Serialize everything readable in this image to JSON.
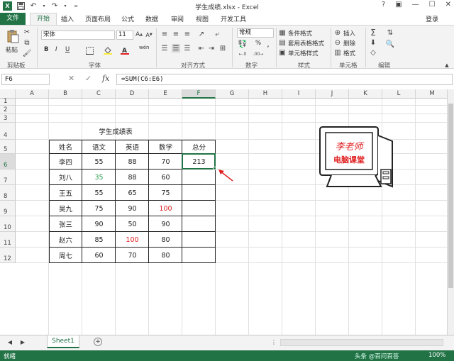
{
  "window": {
    "title": "学生成绩.xlsx - Excel",
    "controls": [
      "?",
      "▣",
      "—",
      "☐",
      "✕"
    ]
  },
  "ribbon_tabs": {
    "file": "文件",
    "active": "开始",
    "items": [
      "插入",
      "页面布局",
      "公式",
      "数据",
      "审阅",
      "视图",
      "开发工具"
    ],
    "signin": "登录"
  },
  "ribbon": {
    "clipboard": {
      "paste": "粘贴",
      "label": "剪贴板"
    },
    "font": {
      "name": "宋体",
      "size": "11",
      "bold": "B",
      "italic": "I",
      "underline": "U",
      "label": "字体",
      "wen": "wén"
    },
    "alignment": {
      "label": "对齐方式"
    },
    "number": {
      "format": "常规",
      "percent": "%",
      "label": "数字"
    },
    "styles": {
      "conditional": "条件格式",
      "table": "套用表格格式",
      "cell": "单元格样式",
      "label": "样式"
    },
    "cells": {
      "insert": "插入",
      "delete": "删除",
      "format": "格式",
      "label": "单元格"
    },
    "editing": {
      "label": "编辑"
    }
  },
  "formula_bar": {
    "name_box": "F6",
    "formula": "=SUM(C6:E6)"
  },
  "grid": {
    "columns": [
      "A",
      "B",
      "C",
      "D",
      "E",
      "F",
      "G",
      "H",
      "I",
      "J",
      "K",
      "L",
      "M"
    ],
    "rows": [
      "1",
      "2",
      "3",
      "4",
      "5",
      "6",
      "7",
      "8",
      "9",
      "10",
      "11",
      "12"
    ],
    "selected_column": "F",
    "selected_row": "6"
  },
  "table": {
    "title": "学生成绩表",
    "headers": [
      "姓名",
      "语文",
      "英语",
      "数学",
      "总分"
    ],
    "rows": [
      [
        "李四",
        "55",
        "88",
        "70",
        "213"
      ],
      [
        "刘八",
        "35",
        "88",
        "60",
        ""
      ],
      [
        "王五",
        "55",
        "65",
        "75",
        ""
      ],
      [
        "吴九",
        "75",
        "90",
        "100",
        ""
      ],
      [
        "张三",
        "90",
        "50",
        "90",
        ""
      ],
      [
        "赵六",
        "85",
        "100",
        "80",
        ""
      ],
      [
        "周七",
        "60",
        "70",
        "80",
        ""
      ]
    ],
    "colors": {
      "green": "#2e9e4f",
      "red": "#e02020"
    }
  },
  "logo": {
    "line1": "李老师",
    "line2": "电脑课堂"
  },
  "sheets": {
    "tabs": [
      "Sheet1"
    ]
  },
  "status": {
    "left": "就绪",
    "zoom": "100%",
    "watermark": "头条 @百问百答"
  }
}
